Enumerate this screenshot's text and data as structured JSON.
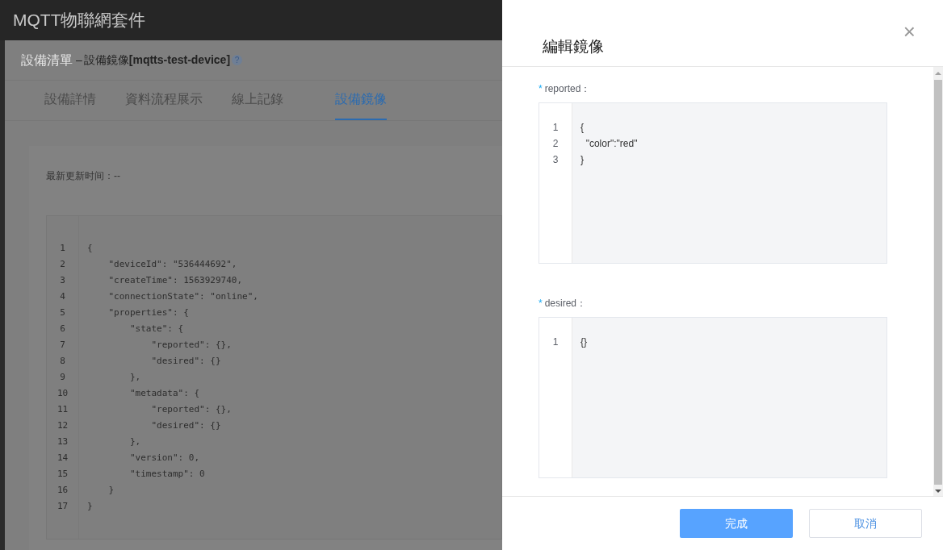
{
  "app": {
    "title": "MQTT物聯網套件"
  },
  "page": {
    "breadcrumb": "設備清單",
    "separator": "–",
    "subtitle": "設備鏡像**[mqtts-test-device]**",
    "help": "?"
  },
  "tabs": [
    {
      "label": "設備詳情",
      "selected": false
    },
    {
      "label": "資料流程展示",
      "selected": false
    },
    {
      "label": "線上記錄",
      "selected": false
    },
    {
      "label": "設備鏡像",
      "selected": true
    }
  ],
  "shadow": {
    "updated": "最新更新时间：--",
    "lines": [
      {
        "number": "1",
        "text": "{"
      },
      {
        "number": "2",
        "text": "    \"deviceId\": \"536444692\","
      },
      {
        "number": "3",
        "text": "    \"createTime\": 1563929740,"
      },
      {
        "number": "4",
        "text": "    \"connectionState\": \"online\","
      },
      {
        "number": "5",
        "text": "    \"properties\": {"
      },
      {
        "number": "6",
        "text": "        \"state\": {"
      },
      {
        "number": "7",
        "text": "            \"reported\": {},"
      },
      {
        "number": "8",
        "text": "            \"desired\": {}"
      },
      {
        "number": "9",
        "text": "        },"
      },
      {
        "number": "10",
        "text": "        \"metadata\": {"
      },
      {
        "number": "11",
        "text": "            \"reported\": {},"
      },
      {
        "number": "12",
        "text": "            \"desired\": {}"
      },
      {
        "number": "13",
        "text": "        },"
      },
      {
        "number": "14",
        "text": "        \"version\": 0,"
      },
      {
        "number": "15",
        "text": "        \"timestamp\": 0"
      },
      {
        "number": "16",
        "text": "    }"
      },
      {
        "number": "17",
        "text": "}"
      }
    ]
  },
  "drawer": {
    "title": "編輯鏡像",
    "close": "×",
    "fields": [
      {
        "marker": "*",
        "label": "reported：",
        "lines": [
          {
            "number": "1",
            "text": "{"
          },
          {
            "number": "2",
            "text": "  \"color\":\"red\""
          },
          {
            "number": "3",
            "text": "}"
          }
        ]
      },
      {
        "marker": "*",
        "label": "desired：",
        "lines": [
          {
            "number": "1",
            "text": "{}"
          }
        ]
      }
    ],
    "buttons": [
      {
        "label": "完成",
        "kind": "primary"
      },
      {
        "label": "取消",
        "kind": "secondary"
      }
    ]
  }
}
